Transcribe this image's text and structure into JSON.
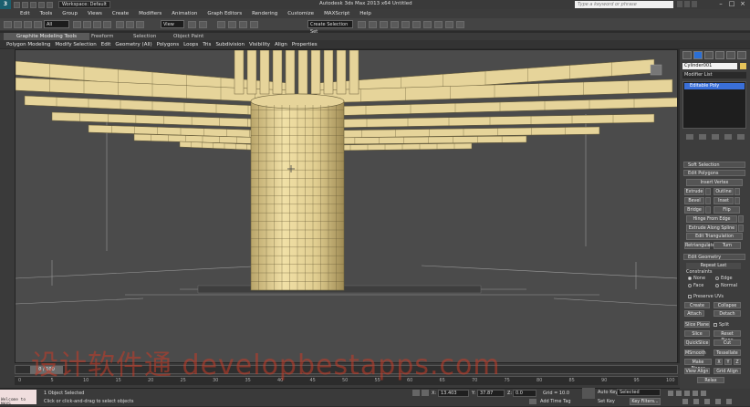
{
  "app": {
    "workspace": "Workspace: Default",
    "title": "Autodesk 3ds Max  2013 x64      Untitled",
    "search_placeholder": "Type a keyword or phrase"
  },
  "menu": [
    "Edit",
    "Tools",
    "Group",
    "Views",
    "Create",
    "Modifiers",
    "Animation",
    "Graph Editors",
    "Rendering",
    "Customize",
    "MAXScript",
    "Help"
  ],
  "toolbar": {
    "selection_filter": "All",
    "ref_coord": "View",
    "named_selection": "Create Selection Set"
  },
  "ribbon": {
    "tabs": [
      "Graphite Modeling Tools",
      "Freeform",
      "Selection",
      "Object Paint"
    ],
    "panels": [
      "Polygon Modeling",
      "Modify Selection",
      "Edit",
      "Geometry (All)",
      "Polygons",
      "Loops",
      "Tris",
      "Subdivision",
      "Visibility",
      "Align",
      "Properties"
    ]
  },
  "command_panel": {
    "object_name": "Cylinder001",
    "modifier_list": "Modifier List",
    "stack_item": "Editable Poly",
    "soft_selection": "Soft Selection",
    "edit_polygons": "Edit Polygons",
    "insert_vertex": "Insert Vertex",
    "extrude": "Extrude",
    "outline": "Outline",
    "bevel": "Bevel",
    "inset": "Inset",
    "bridge": "Bridge",
    "flip": "Flip",
    "hinge_from_edge": "Hinge From Edge",
    "extrude_along_spline": "Extrude Along Spline",
    "edit_triangulation": "Edit Triangulation",
    "retriangulate": "Retriangulate",
    "turn": "Turn",
    "edit_geometry": "Edit Geometry",
    "repeat_last": "Repeat Last",
    "constraints": "Constraints",
    "none": "None",
    "edge": "Edge",
    "face": "Face",
    "normal": "Normal",
    "preserve_uvs": "Preserve UVs",
    "create": "Create",
    "collapse": "Collapse",
    "attach": "Attach",
    "detach": "Detach",
    "slice_plane": "Slice Plane",
    "split": "Split",
    "slice": "Slice",
    "reset_plane": "Reset Plane",
    "quickslice": "QuickSlice",
    "cut": "Cut",
    "msmooth": "MSmooth",
    "tessellate": "Tessellate",
    "make_planar": "Make Planar",
    "x": "X",
    "y": "Y",
    "z": "Z",
    "view_align": "View Align",
    "grid_align": "Grid Align",
    "relax": "Relax"
  },
  "timeline": {
    "frame": "0 / 100",
    "ticks": [
      "0",
      "5",
      "10",
      "15",
      "20",
      "25",
      "30",
      "35",
      "40",
      "45",
      "50",
      "55",
      "60",
      "65",
      "70",
      "75",
      "80",
      "85",
      "90",
      "95",
      "100"
    ]
  },
  "status": {
    "maxscript_line1": "Welcome to MAXS",
    "selection": "1 Object Selected",
    "prompt": "Click or click-and-drag to select objects",
    "x_label": "X:",
    "x_value": "13.403",
    "y_label": "Y:",
    "y_value": "37.87",
    "z_label": "Z:",
    "z_value": "0.0",
    "grid": "Grid = 10.0",
    "add_time_tag": "Add Time Tag",
    "auto_key": "Auto Key",
    "selected": "Selected",
    "set_key": "Set Key",
    "key_filters": "Key Filters..."
  },
  "watermark": "设计软件通 developbestapps.com",
  "colors": {
    "mesh": "#e6d49a",
    "mesh_edge": "#6a5f3a",
    "viewport_bg": "#4b4b4b",
    "stack_highlight": "#3a6fd8"
  }
}
